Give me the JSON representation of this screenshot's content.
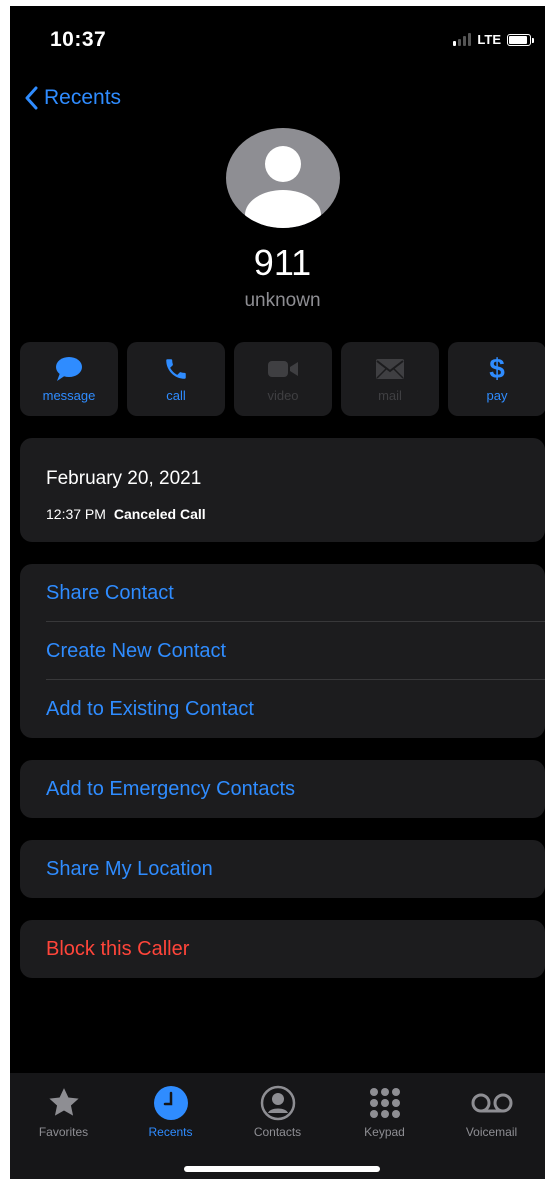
{
  "status_bar": {
    "time": "10:37",
    "network": "LTE",
    "signal_bars_active": 1,
    "battery_level": 0.9
  },
  "nav": {
    "back_label": "Recents"
  },
  "contact": {
    "number": "911",
    "label": "unknown"
  },
  "actions": [
    {
      "id": "message",
      "label": "message",
      "icon": "message-bubble-icon",
      "enabled": true
    },
    {
      "id": "call",
      "label": "call",
      "icon": "phone-icon",
      "enabled": true
    },
    {
      "id": "video",
      "label": "video",
      "icon": "video-camera-icon",
      "enabled": false
    },
    {
      "id": "mail",
      "label": "mail",
      "icon": "envelope-icon",
      "enabled": false
    },
    {
      "id": "pay",
      "label": "pay",
      "icon": "dollar-icon",
      "enabled": true
    }
  ],
  "call_history": {
    "date": "February 20, 2021",
    "time": "12:37 PM",
    "status": "Canceled Call"
  },
  "options": {
    "share_contact": "Share Contact",
    "create_new_contact": "Create New Contact",
    "add_to_existing_contact": "Add to Existing Contact",
    "add_to_emergency_contacts": "Add to Emergency Contacts",
    "share_my_location": "Share My Location",
    "block_this_caller": "Block this Caller"
  },
  "tabs": [
    {
      "label": "Favorites",
      "icon": "star-icon",
      "active": false
    },
    {
      "label": "Recents",
      "icon": "clock-icon",
      "active": true
    },
    {
      "label": "Contacts",
      "icon": "person-circle-icon",
      "active": false
    },
    {
      "label": "Keypad",
      "icon": "keypad-icon",
      "active": false
    },
    {
      "label": "Voicemail",
      "icon": "voicemail-icon",
      "active": false
    }
  ],
  "colors": {
    "accent": "#2f8cff",
    "danger": "#ff453a",
    "background": "#000000",
    "card": "#1c1c1e"
  }
}
